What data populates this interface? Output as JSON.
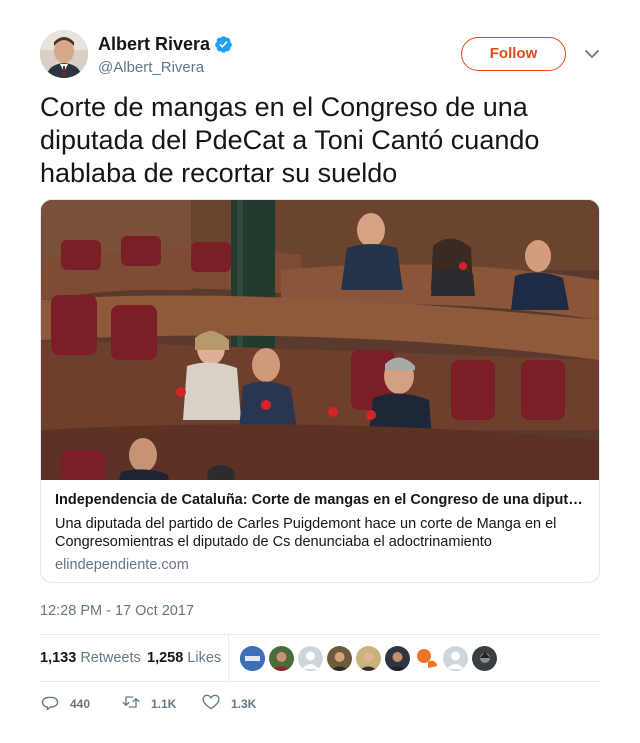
{
  "user": {
    "display_name": "Albert Rivera",
    "handle": "@Albert_Rivera",
    "verified": true,
    "avatar_icon": "profile-photo"
  },
  "follow_label": "Follow",
  "accent_color": "#e0491a",
  "tweet_text": "Corte de mangas en el Congreso de una diputada del PdeCat a Toni Cantó cuando hablaba de recortar su sueldo",
  "card": {
    "title": "Independencia de Cataluña: Corte de mangas en el Congreso de una diputada del PdeCat a Toni Cantó cuando hablaba de recortar su sueldo",
    "description": "Una diputada del partido de Carles Puigdemont hace un corte de Manga en el Congresomientras el diputado de Cs denunciaba el adoctrinamiento",
    "domain": "elindependiente.com",
    "image_icon": "congress-photo"
  },
  "timestamp": "12:28 PM - 17 Oct 2017",
  "stats": {
    "retweets_count": "1,133",
    "retweets_label": "Retweets",
    "likes_count": "1,258",
    "likes_label": "Likes"
  },
  "actions": {
    "reply_count": "440",
    "retweet_count": "1.1K",
    "like_count": "1.3K"
  }
}
